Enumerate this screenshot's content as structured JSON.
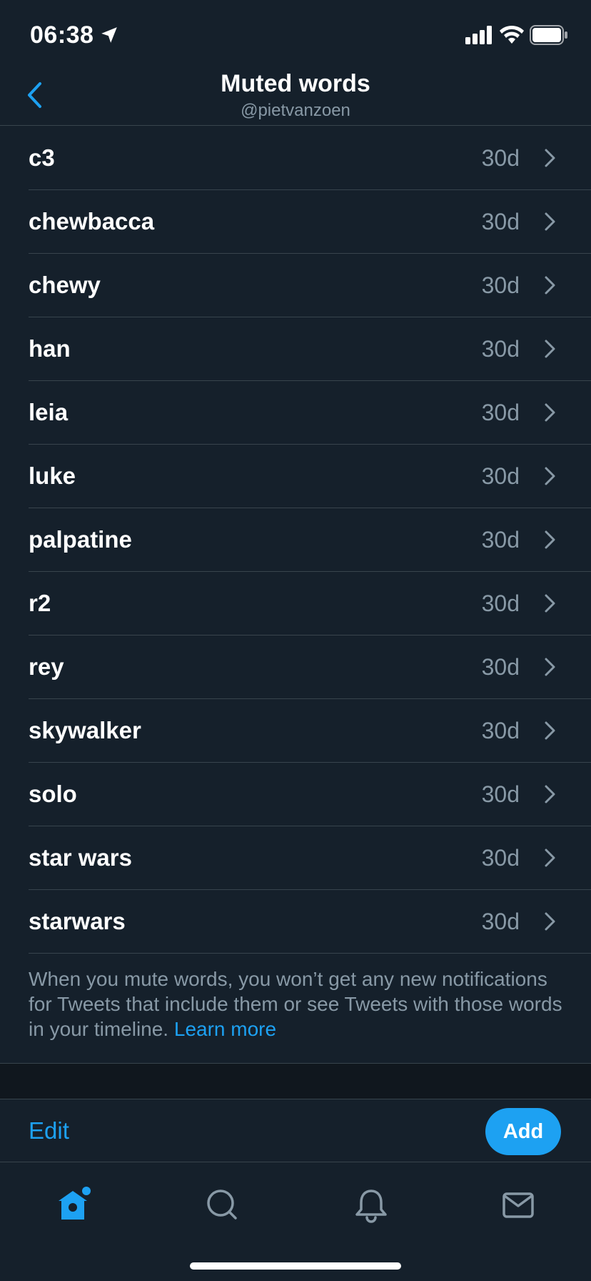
{
  "status_bar": {
    "time": "06:38",
    "icons": [
      "location-arrow-icon",
      "signal-icon",
      "wifi-icon",
      "battery-icon"
    ]
  },
  "header": {
    "title": "Muted words",
    "subtitle": "@pietvanzoen",
    "back_icon": "chevron-left-icon"
  },
  "muted_words": [
    {
      "word": "c3",
      "duration": "30d"
    },
    {
      "word": "chewbacca",
      "duration": "30d"
    },
    {
      "word": "chewy",
      "duration": "30d"
    },
    {
      "word": "han",
      "duration": "30d"
    },
    {
      "word": "leia",
      "duration": "30d"
    },
    {
      "word": "luke",
      "duration": "30d"
    },
    {
      "word": "palpatine",
      "duration": "30d"
    },
    {
      "word": "r2",
      "duration": "30d"
    },
    {
      "word": "rey",
      "duration": "30d"
    },
    {
      "word": "skywalker",
      "duration": "30d"
    },
    {
      "word": "solo",
      "duration": "30d"
    },
    {
      "word": "star wars",
      "duration": "30d"
    },
    {
      "word": "starwars",
      "duration": "30d"
    }
  ],
  "footer": {
    "note": "When you mute words, you won’t get any new notifications for Tweets that include them or see Tweets with those words in your timeline.",
    "learn_more": "Learn more"
  },
  "actions": {
    "edit_label": "Edit",
    "add_label": "Add"
  },
  "tabs": [
    {
      "name": "home",
      "icon": "home-icon",
      "active": true
    },
    {
      "name": "search",
      "icon": "search-icon",
      "active": false
    },
    {
      "name": "notifications",
      "icon": "bell-icon",
      "active": false
    },
    {
      "name": "messages",
      "icon": "mail-icon",
      "active": false
    }
  ],
  "colors": {
    "background": "#15202b",
    "accent": "#1da1f2",
    "secondary_text": "#8899a6",
    "divider": "#38444d"
  }
}
